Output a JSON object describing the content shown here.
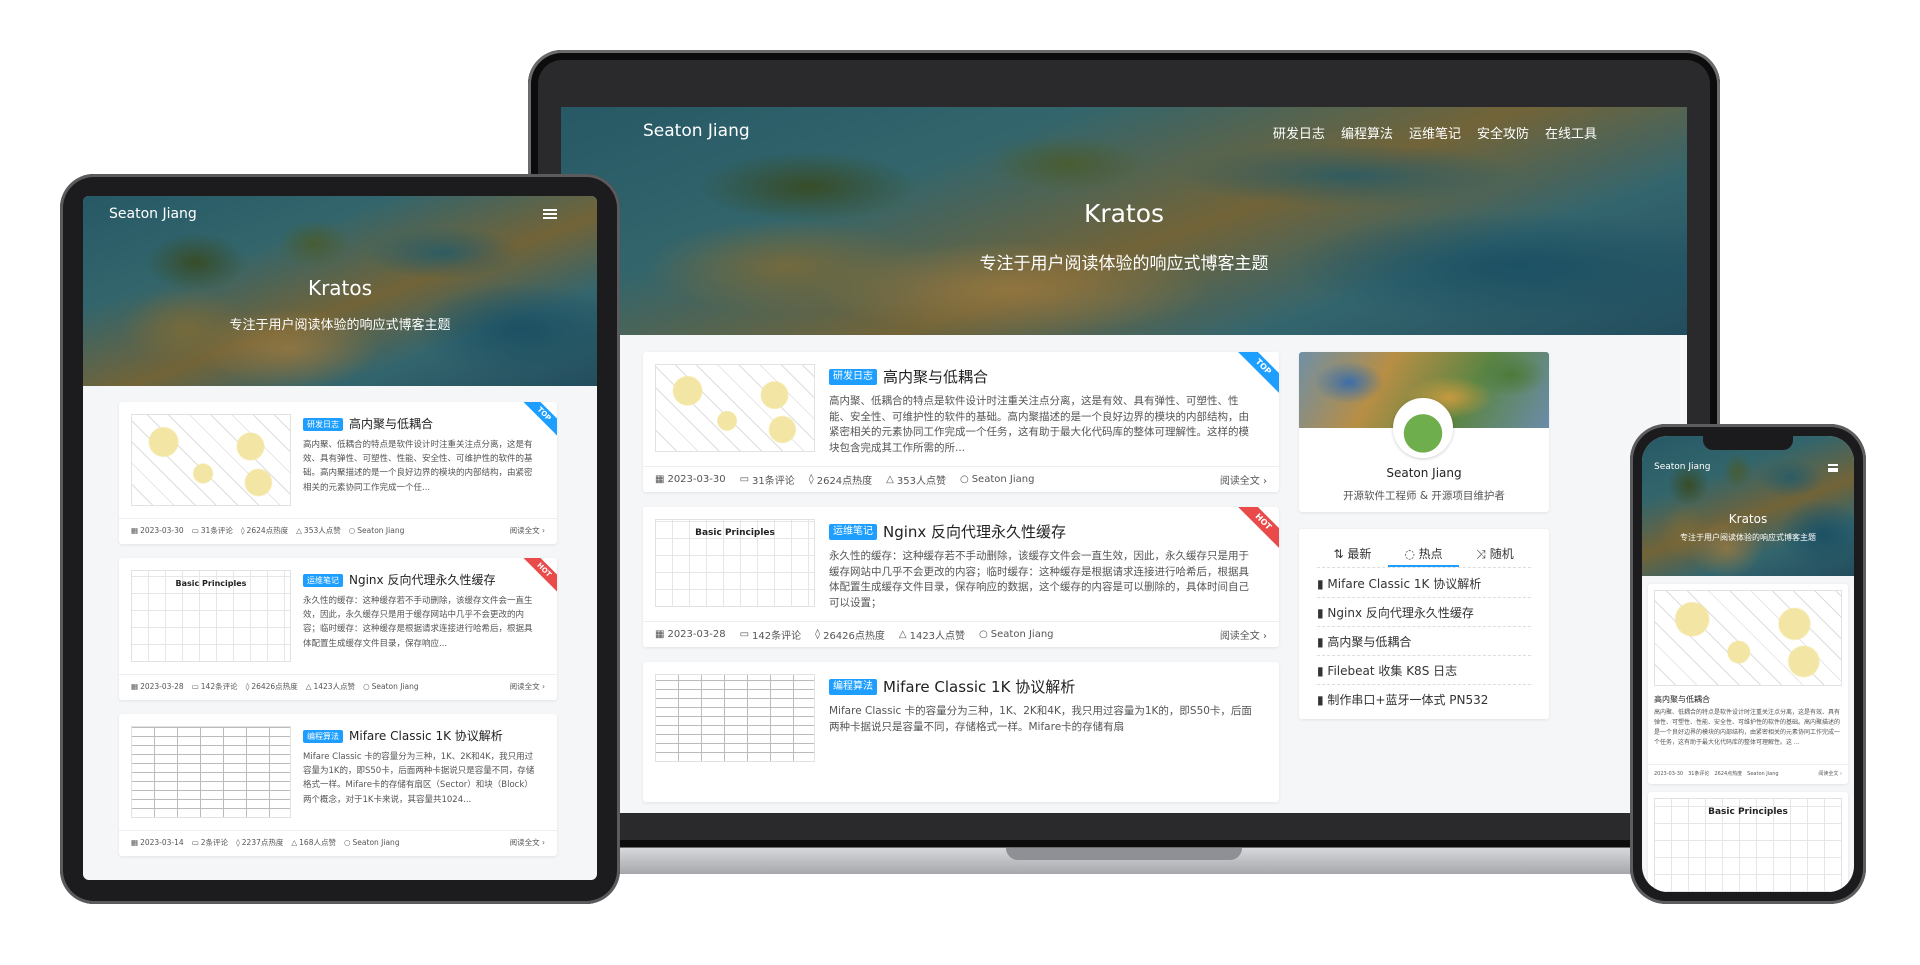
{
  "brand": "Seaton Jiang",
  "nav": [
    "研发日志",
    "编程算法",
    "运维笔记",
    "安全攻防",
    "在线工具"
  ],
  "hero": {
    "title": "Kratos",
    "subtitle": "专注于用户阅读体验的响应式博客主题"
  },
  "posts": [
    {
      "tag": "研发日志",
      "title": "高内聚与低耦合",
      "ribbon": "TOP",
      "excerpt_laptop": "高内聚、低耦合的特点是软件设计时注重关注点分离，这是有效、具有弹性、可塑性、性能、安全性、可维护性的软件的基础。高内聚描述的是一个良好边界的模块的内部结构，由紧密相关的元素协同工作完成一个任务，这有助于最大化代码库的整体可理解性。这样的模块包含完成其工作所需的所...",
      "excerpt_tablet": "高内聚、低耦合的特点是软件设计时注重关注点分离，这是有效、具有弹性、可塑性、性能、安全性、可维护性的软件的基础。高内聚描述的是一个良好边界的模块的内部结构，由紧密相关的元素协同工作完成一个任...",
      "excerpt_phone": "高内聚、低耦合的特点是软件设计时注重关注点分离，这是有效、具有弹性、可塑性、性能、安全性、可维护性的软件的基础。高内聚描述的是一个良好边界的模块的内部结构，由紧密相关的元素协同工作完成一个任务，这有助于最大化代码库的整体可理解性。这 ...",
      "date": "2023-03-30",
      "comments": "31条评论",
      "heat": "2624点热度",
      "likes": "353人点赞",
      "author": "Seaton Jiang",
      "read_more": "阅读全文"
    },
    {
      "tag": "运维笔记",
      "title": "Nginx 反向代理永久性缓存",
      "ribbon": "HOT",
      "thumb_caption": "Basic Principles",
      "excerpt_laptop": "永久性的缓存：这种缓存若不手动删除，该缓存文件会一直生效，因此，永久缓存只是用于缓存网站中几乎不会更改的内容；临时缓存：这种缓存是根据请求连接进行哈希后，根据具体配置生成缓存文件目录，保存响应的数据，这个缓存的内容是可以删除的，具体时间自己可以设置；",
      "excerpt_tablet": "永久性的缓存：这种缓存若不手动删除，该缓存文件会一直生效，因此，永久缓存只是用于缓存网站中几乎不会更改的内容；临时缓存：这种缓存是根据请求连接进行哈希后，根据具体配置生成缓存文件目录，保存响应...",
      "date": "2023-03-28",
      "comments": "142条评论",
      "heat": "26426点热度",
      "likes": "1423人点赞",
      "author": "Seaton Jiang",
      "read_more": "阅读全文"
    },
    {
      "tag": "编程算法",
      "title": "Mifare Classic 1K 协议解析",
      "excerpt_laptop": "Mifare Classic 卡的容量分为三种，1K、2K和4K，我只用过容量为1K的，即S50卡，后面两种卡据说只是容量不同，存储格式一样。Mifare卡的存储有扇",
      "excerpt_tablet": "Mifare Classic 卡的容量分为三种，1K、2K和4K，我只用过容量为1K的，即S50卡，后面两种卡据说只是容量不同，存储格式一样。Mifare卡的存储有扇区（Sector）和块（Block）两个概念，对于1K卡来说，其容量共1024...",
      "date": "2023-03-14",
      "comments": "2条评论",
      "heat": "2237点热度",
      "likes": "168人点赞",
      "author": "Seaton Jiang",
      "read_more": "阅读全文"
    }
  ],
  "profile": {
    "name": "Seaton Jiang",
    "bio": "开源软件工程师 & 开源项目维护者"
  },
  "widget": {
    "tabs": [
      {
        "label": "最新",
        "icon": "sort-icon"
      },
      {
        "label": "热点",
        "icon": "fire-icon"
      },
      {
        "label": "随机",
        "icon": "shuffle-icon"
      }
    ],
    "active_tab": "热点",
    "items": [
      "Mifare Classic 1K 协议解析",
      "Nginx 反向代理永久性缓存",
      "高内聚与低耦合",
      "Filebeat 收集 K8S 日志",
      "制作串口+蓝牙一体式 PN532"
    ]
  },
  "colors": {
    "accent": "#1e9fff",
    "ribbon_top": "#1e9fff",
    "ribbon_hot": "#e94a4a",
    "page_bg": "#f5f6f8"
  }
}
